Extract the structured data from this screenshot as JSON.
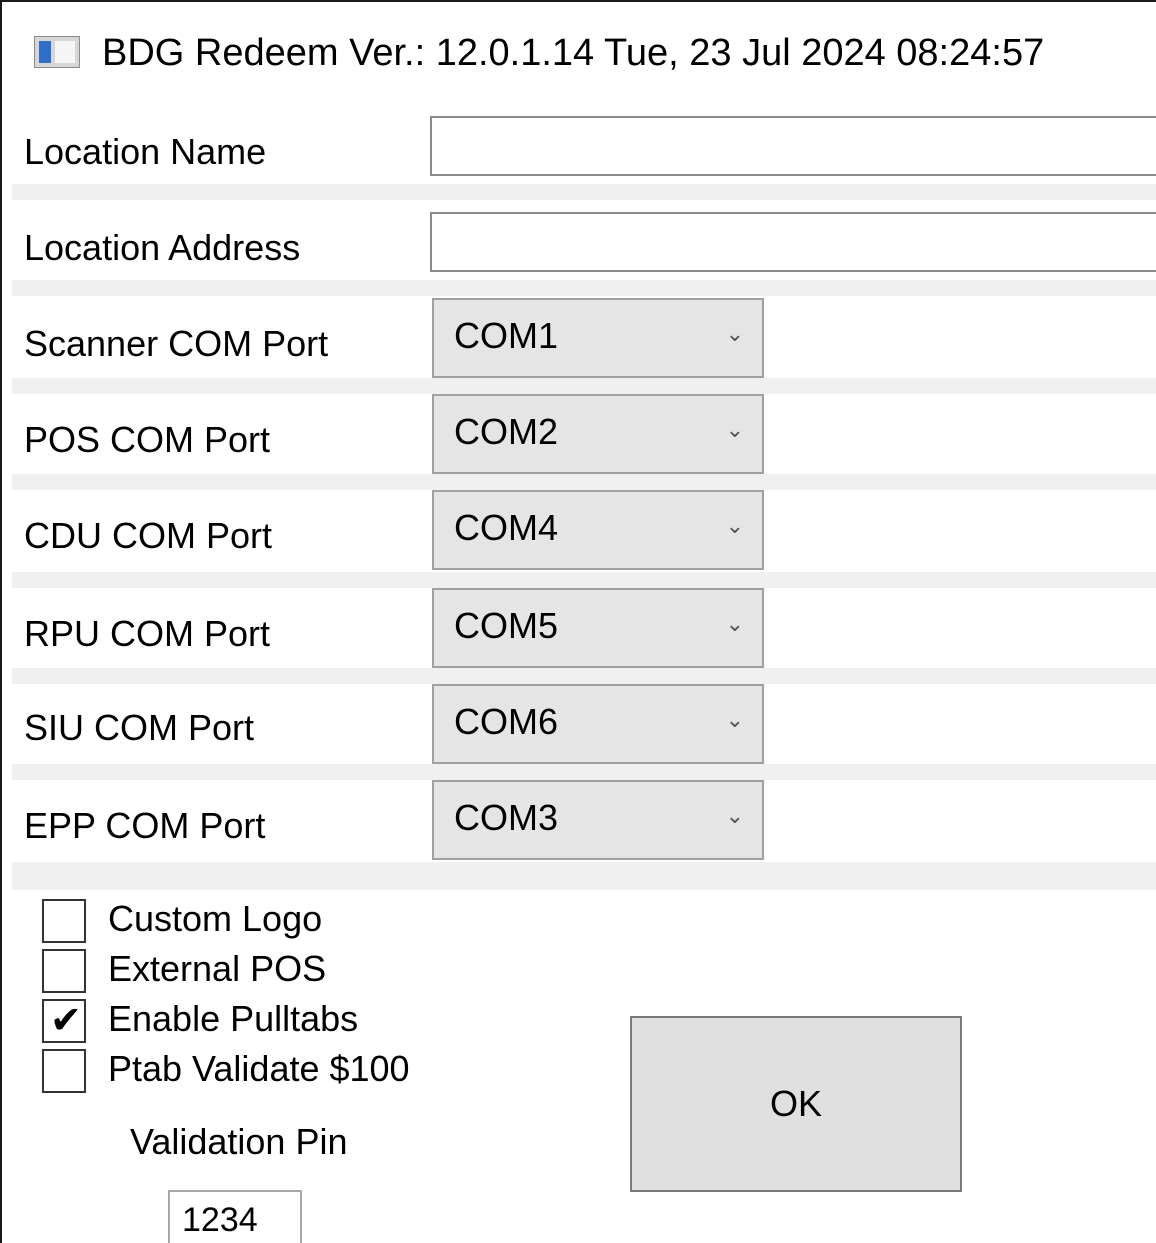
{
  "window": {
    "title": "BDG Redeem Ver.: 12.0.1.14 Tue, 23 Jul 2024 08:24:57",
    "icon": "app-window-icon"
  },
  "form": {
    "location_name": {
      "label": "Location Name",
      "value": ""
    },
    "location_address": {
      "label": "Location Address",
      "value": ""
    },
    "ports": [
      {
        "label": "Scanner COM Port",
        "value": "COM1"
      },
      {
        "label": "POS COM Port",
        "value": "COM2"
      },
      {
        "label": "CDU COM Port",
        "value": "COM4"
      },
      {
        "label": "RPU COM Port",
        "value": "COM5"
      },
      {
        "label": "SIU COM Port",
        "value": "COM6"
      },
      {
        "label": "EPP COM Port",
        "value": "COM3"
      }
    ]
  },
  "options": [
    {
      "label": "Custom Logo",
      "checked": false
    },
    {
      "label": "External POS",
      "checked": false
    },
    {
      "label": "Enable Pulltabs",
      "checked": true
    },
    {
      "label": "Ptab Validate $100",
      "checked": false
    }
  ],
  "validation": {
    "label": "Validation Pin",
    "value": "1234"
  },
  "buttons": {
    "ok_label": "OK"
  },
  "glyphs": {
    "dropdown_arrow": "⌄",
    "checkmark": "✔"
  }
}
